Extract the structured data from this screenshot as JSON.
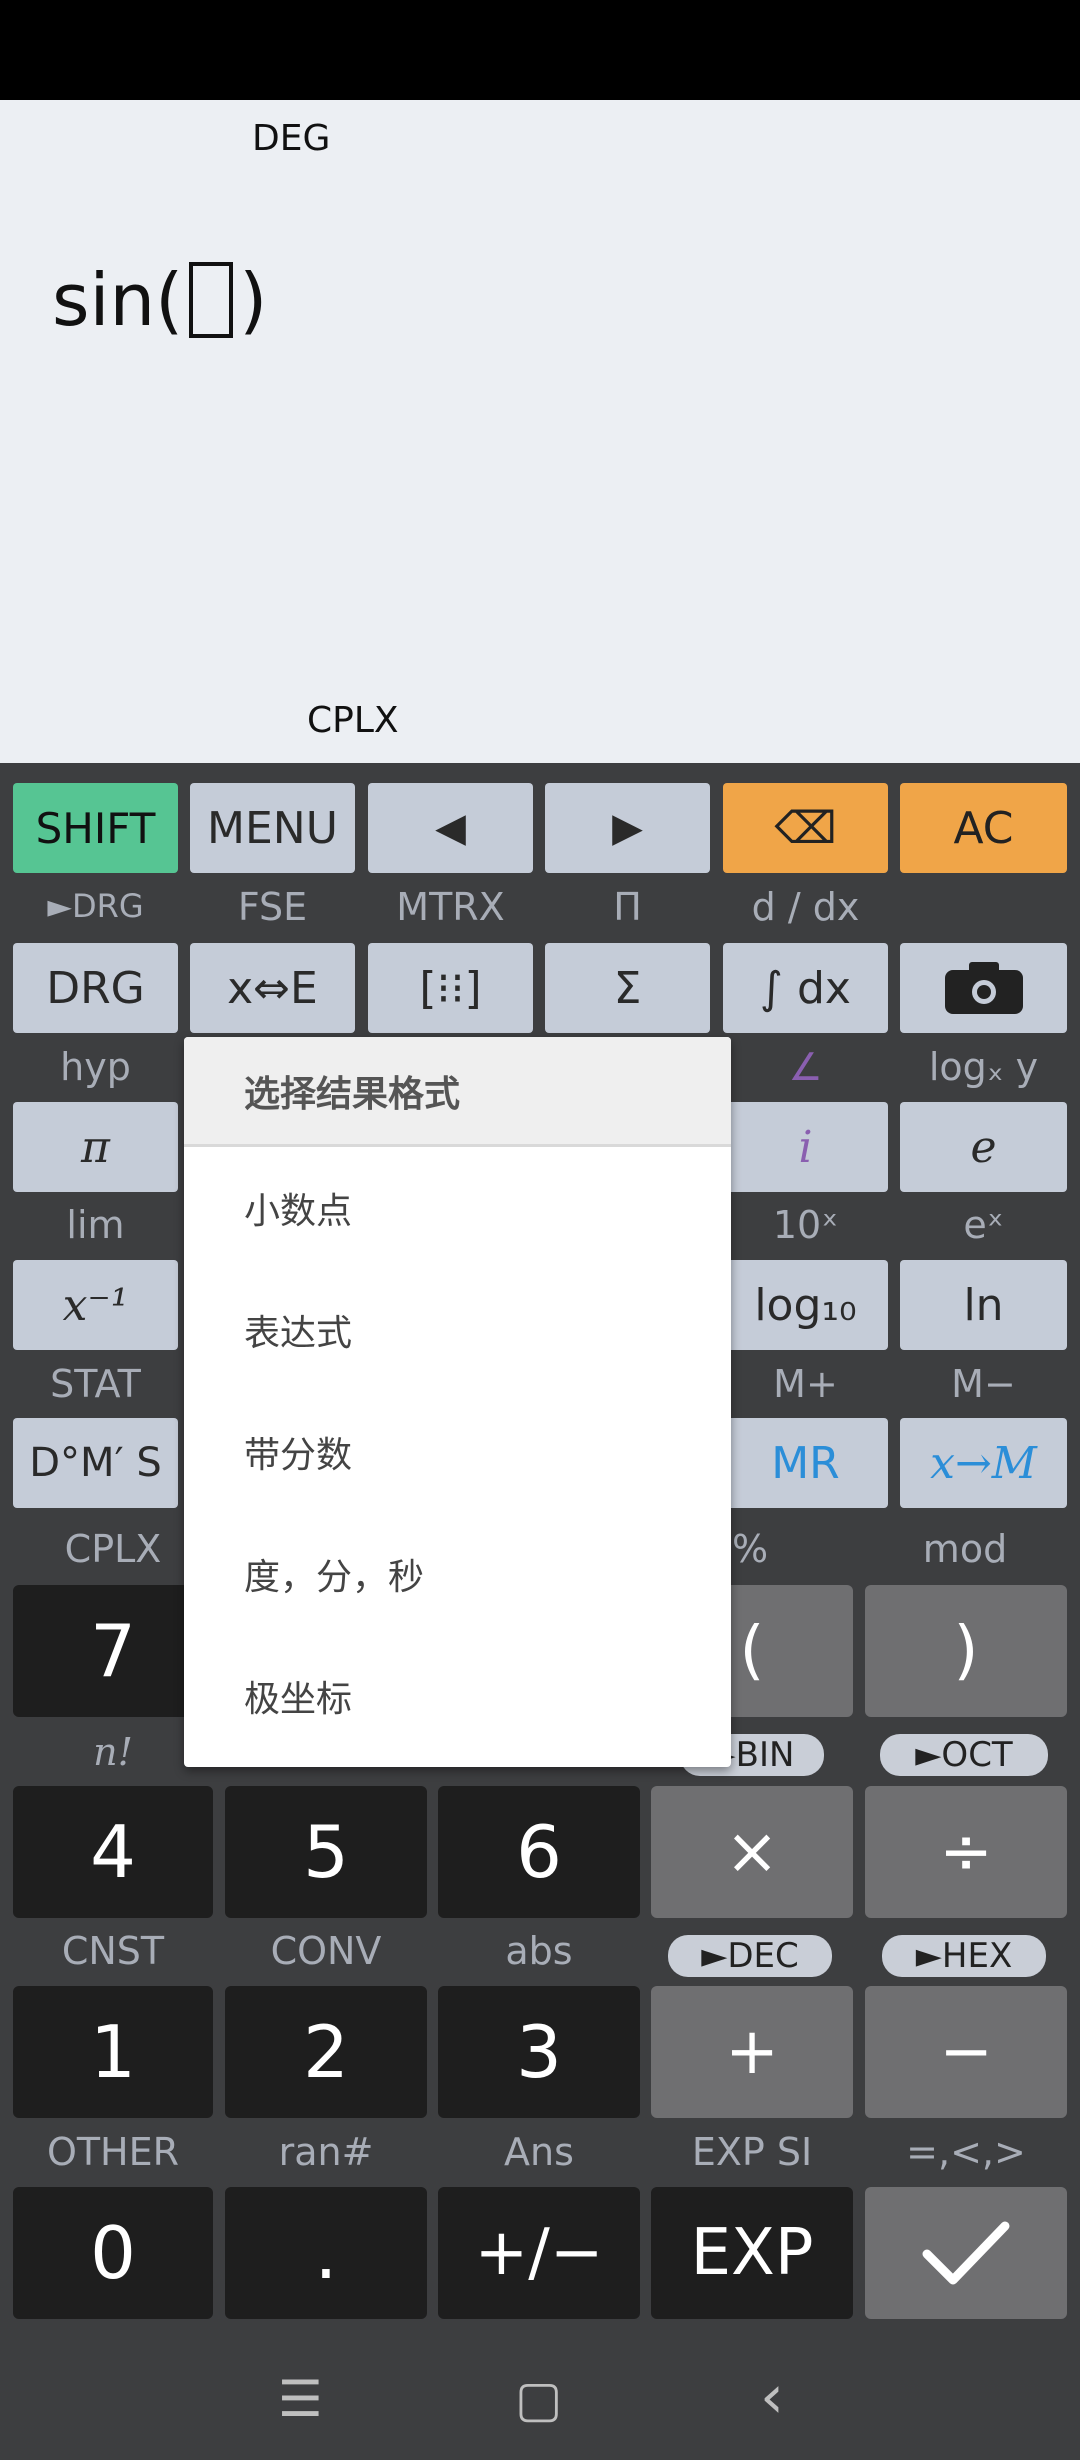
{
  "display": {
    "angle_mode": "DEG",
    "complex_mode": "CPLX",
    "expression_prefix": "sin(",
    "expression_suffix": ")"
  },
  "keys": {
    "shift": "SHIFT",
    "menu": "MENU",
    "left": "◀",
    "right": "▶",
    "backspace": "⌫",
    "ac": "AC",
    "drg": "DRG",
    "xe": "x⇔E",
    "matrix": "[⁝⁝]",
    "sigma": "Σ",
    "integral": "∫ dx",
    "camera": "📷",
    "pi": "π",
    "i": "i",
    "e": "e",
    "x_inv": "x⁻¹",
    "log10": "log₁₀",
    "ln": "ln",
    "dms": "D°M′ S",
    "mr": "MR",
    "xm": "x→M",
    "seven": "7",
    "open_paren": "(",
    "close_paren": ")",
    "four": "4",
    "five": "5",
    "six": "6",
    "multiply": "×",
    "divide": "÷",
    "one": "1",
    "two": "2",
    "three": "3",
    "plus": "+",
    "minus": "−",
    "zero": "0",
    "dot": ".",
    "plus_minus": "+/−",
    "exp": "EXP",
    "enter": "✓"
  },
  "secondary": {
    "drg": "►DRG",
    "fse": "FSE",
    "mtrx": "MTRX",
    "product": "Π",
    "ddx": "d / dx",
    "hyp": "hyp",
    "angle": "∠",
    "logxy": "logₓ y",
    "lim": "lim",
    "ten_x": "10ˣ",
    "e_x": "eˣ",
    "stat": "STAT",
    "m_plus": "M+",
    "m_minus": "M−",
    "cplx": "CPLX",
    "percent": "%",
    "mod": "mod",
    "factorial": "n!",
    "bin": "►BIN",
    "oct": "►OCT",
    "cnst": "CNST",
    "conv": "CONV",
    "abs": "abs",
    "dec": "►DEC",
    "hex": "►HEX",
    "other": "OTHER",
    "ran": "ran#",
    "ans": "Ans",
    "exp_si": "EXP SI",
    "compare": "=,<,>"
  },
  "menu": {
    "title": "选择结果格式",
    "items": [
      "小数点",
      "表达式",
      "带分数",
      "度，分，秒",
      "极坐标"
    ]
  },
  "nav": {
    "menu": "☰",
    "home": "▢",
    "back": "‹"
  },
  "colors": {
    "shift": "#56c593",
    "accent": "#f0a548",
    "memory": "#2b8ed8",
    "complex": "#8a5fb0"
  }
}
